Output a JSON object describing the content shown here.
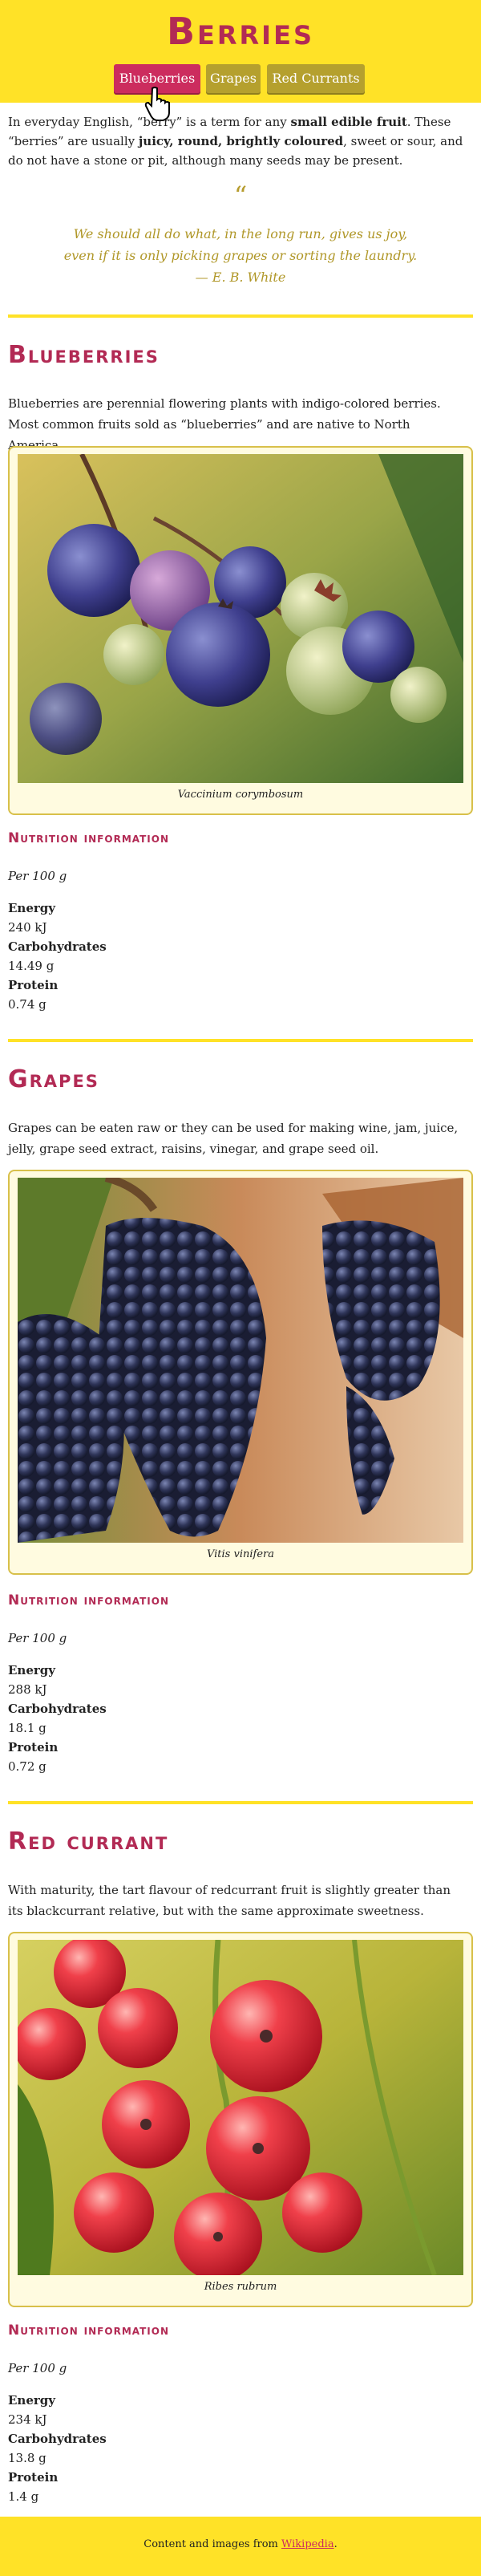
{
  "header": {
    "title": "Berries",
    "nav": [
      {
        "label": "Blueberries",
        "active": true
      },
      {
        "label": "Grapes",
        "active": false
      },
      {
        "label": "Red Currants",
        "active": false
      }
    ]
  },
  "intro": {
    "p1": "In everyday English, “berry” is a term for any ",
    "b1": "small edible fruit",
    "p2": ". These “berries” are usually ",
    "b2": "juicy, round, brightly coloured",
    "p3": ", sweet or sour, and do not have a stone or pit, although many seeds may be present."
  },
  "quote": {
    "mark": "“",
    "line1": "We should all do what, in the long run, gives us joy,",
    "line2": "even if it is only picking grapes or sorting the laundry.",
    "attribution": "— E. B. White"
  },
  "sections": {
    "blueberries": {
      "title": "Blueberries",
      "description": "Blueberries are perennial flowering plants with indigo-colored berries. Most common fruits sold as “blueberries” and are native to North America.",
      "caption": "Vaccinium corymbosum",
      "nutrition_title": "Nutrition information",
      "per": "Per 100 g",
      "energy_label": "Energy",
      "energy": "240 kJ",
      "carbs_label": "Carbohydrates",
      "carbs": "14.49 g",
      "protein_label": "Protein",
      "protein": "0.74 g"
    },
    "grapes": {
      "title": "Grapes",
      "description": "Grapes can be eaten raw or they can be used for making wine, jam, juice, jelly, grape seed extract, raisins, vinegar, and grape seed oil.",
      "caption": "Vitis vinifera",
      "nutrition_title": "Nutrition information",
      "per": "Per 100 g",
      "energy_label": "Energy",
      "energy": "288 kJ",
      "carbs_label": "Carbohydrates",
      "carbs": "18.1 g",
      "protein_label": "Protein",
      "protein": "0.72 g"
    },
    "red_currant": {
      "title": "Red currant",
      "description": "With maturity, the tart flavour of redcurrant fruit is slightly greater than its blackcurrant relative, but with the same approximate sweetness.",
      "caption": "Ribes rubrum",
      "nutrition_title": "Nutrition information",
      "per": "Per 100 g",
      "energy_label": "Energy",
      "energy": "234 kJ",
      "carbs_label": "Carbohydrates",
      "carbs": "13.8 g",
      "protein_label": "Protein",
      "protein": "1.4 g"
    }
  },
  "footer": {
    "text": "Content and images from ",
    "link": "Wikipedia",
    "end": "."
  },
  "colors": {
    "accent": "#ffe227",
    "brand": "#b22a54",
    "tab": "#b5a02e",
    "tab_active": "#cc2c5e"
  }
}
